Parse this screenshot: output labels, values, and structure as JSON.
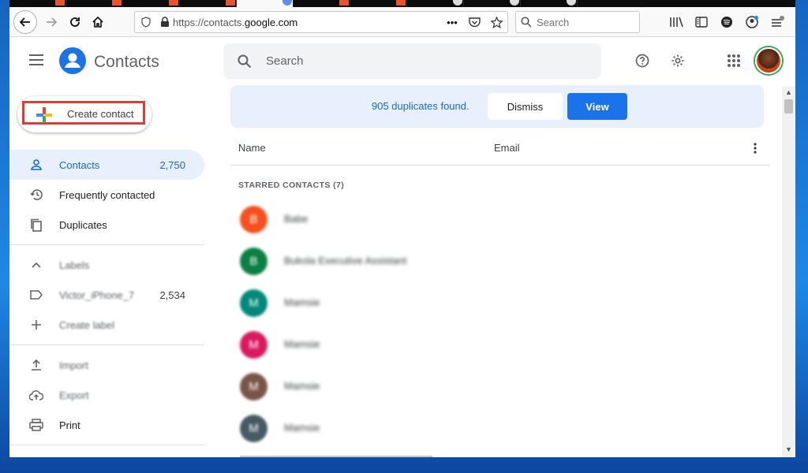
{
  "browser": {
    "url_prefix": "https://contacts.",
    "url_domain": "google.com",
    "search_placeholder": "Search",
    "url_actions_glyph": "•••"
  },
  "app": {
    "title": "Contacts",
    "search_placeholder": "Search",
    "create_label": "Create contact"
  },
  "nav": {
    "contacts_label": "Contacts",
    "contacts_count": "2,750",
    "frequent_label": "Frequently contacted",
    "duplicates_label": "Duplicates",
    "labels_label": "Labels",
    "label_item_label": "Victor_iPhone_7",
    "label_item_count": "2,534",
    "create_label_label": "Create label",
    "import_label": "Import",
    "export_label": "Export",
    "print_label": "Print"
  },
  "banner": {
    "message": "905 duplicates found.",
    "dismiss_label": "Dismiss",
    "view_label": "View"
  },
  "list": {
    "col_name": "Name",
    "col_email": "Email",
    "section_title": "STARRED CONTACTS (7)",
    "rows": [
      {
        "initial": "B",
        "name": "Babe",
        "color": "#f4511e"
      },
      {
        "initial": "B",
        "name": "Bukola Executive Assistant",
        "color": "#0b8043"
      },
      {
        "initial": "M",
        "name": "Mamsie",
        "color": "#00897b"
      },
      {
        "initial": "M",
        "name": "Mamsie",
        "color": "#d81b60"
      },
      {
        "initial": "M",
        "name": "Mamsie",
        "color": "#795548"
      },
      {
        "initial": "M",
        "name": "Mamsie",
        "color": "#455a64"
      }
    ]
  },
  "colors": {
    "accent": "#1a73e8",
    "active_bg": "#e8f0fe",
    "highlight_box": "#e53935"
  }
}
